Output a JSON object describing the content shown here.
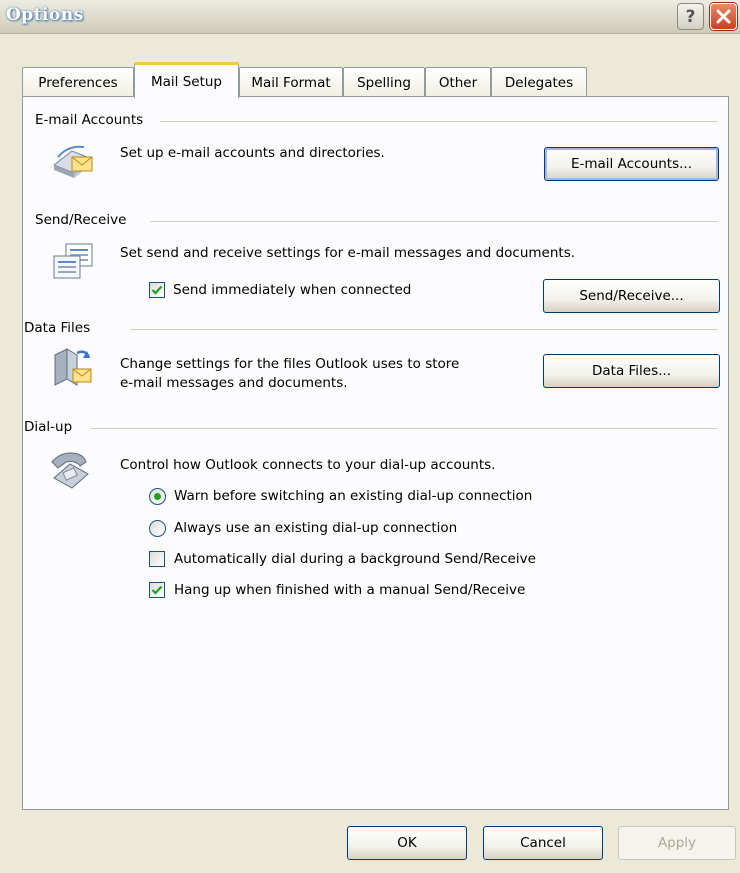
{
  "window": {
    "title": "Options"
  },
  "tabs": [
    "Preferences",
    "Mail Setup",
    "Mail Format",
    "Spelling",
    "Other",
    "Delegates"
  ],
  "email_accounts": {
    "label": "E-mail Accounts",
    "description": "Set up e-mail accounts and directories.",
    "button": "E-mail Accounts..."
  },
  "send_receive": {
    "label": "Send/Receive",
    "description": "Set send and receive settings for e-mail messages and documents.",
    "checkbox": "Send immediately when connected",
    "checkbox_checked": true,
    "button": "Send/Receive..."
  },
  "data_files": {
    "label": "Data Files",
    "description_line1": "Change settings for the files Outlook uses to store",
    "description_line2": "e-mail messages and documents.",
    "button": "Data Files..."
  },
  "dialup": {
    "label": "Dial-up",
    "description": "Control how Outlook connects to your dial-up accounts.",
    "radio1": "Warn before switching an existing dial-up connection",
    "radio1_selected": true,
    "radio2": "Always use an existing dial-up connection",
    "radio2_selected": false,
    "check1": "Automatically dial during a background Send/Receive",
    "check1_checked": false,
    "check2": "Hang up when finished with a manual Send/Receive",
    "check2_checked": true
  },
  "footer": {
    "ok": "OK",
    "cancel": "Cancel",
    "apply": "Apply"
  }
}
